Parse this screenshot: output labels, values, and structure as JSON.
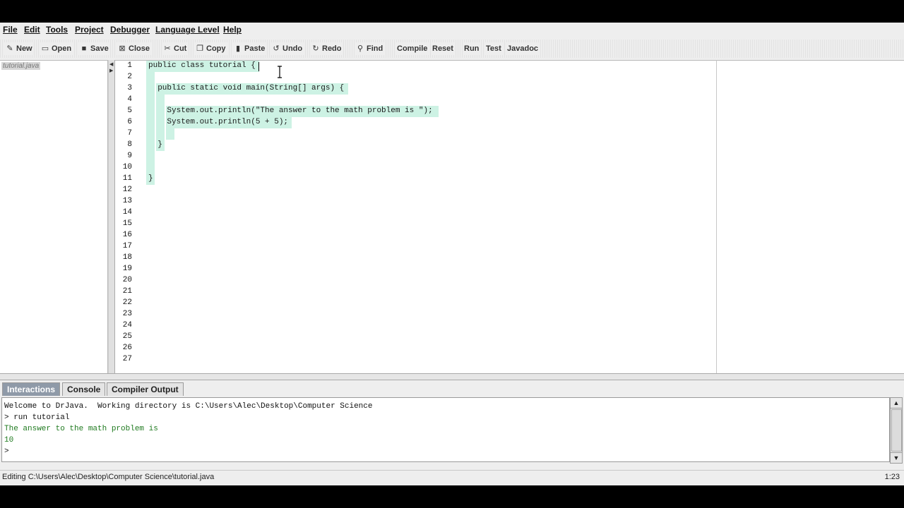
{
  "menu": [
    "File",
    "Edit",
    "Tools",
    "Project",
    "Debugger",
    "Language Level",
    "Help"
  ],
  "toolbar": {
    "new": "New",
    "open": "Open",
    "save": "Save",
    "close": "Close",
    "cut": "Cut",
    "copy": "Copy",
    "paste": "Paste",
    "undo": "Undo",
    "redo": "Redo",
    "find": "Find",
    "compile": "Compile",
    "reset": "Reset",
    "run": "Run",
    "test": "Test",
    "javadoc": "Javadoc"
  },
  "files": [
    "tutorial.java"
  ],
  "editor": {
    "lines": [
      "public class tutorial {",
      "",
      "  public static void main(String[] args) {",
      "",
      "    System.out.println(\"The answer to the math problem is \");",
      "    System.out.println(5 + 5);",
      "",
      "  }",
      "",
      "",
      "}",
      "",
      "",
      "",
      "",
      "",
      "",
      "",
      "",
      "",
      "",
      "",
      "",
      "",
      "",
      "",
      ""
    ],
    "line_numbers": [
      "1",
      "2",
      "3",
      "4",
      "5",
      "6",
      "7",
      "8",
      "9",
      "10",
      "11",
      "12",
      "13",
      "14",
      "15",
      "16",
      "17",
      "18",
      "19",
      "20",
      "21",
      "22",
      "23",
      "24",
      "25",
      "26",
      "27"
    ]
  },
  "tabs": [
    "Interactions",
    "Console",
    "Compiler Output"
  ],
  "interactions": {
    "lines": [
      "Welcome to DrJava.  Working directory is C:\\Users\\Alec\\Desktop\\Computer Science",
      "> run tutorial",
      "The answer to the math problem is ",
      "10",
      "> "
    ]
  },
  "status": {
    "left": "Editing C:\\Users\\Alec\\Desktop\\Computer Science\\tutorial.java",
    "right": "1:23"
  }
}
